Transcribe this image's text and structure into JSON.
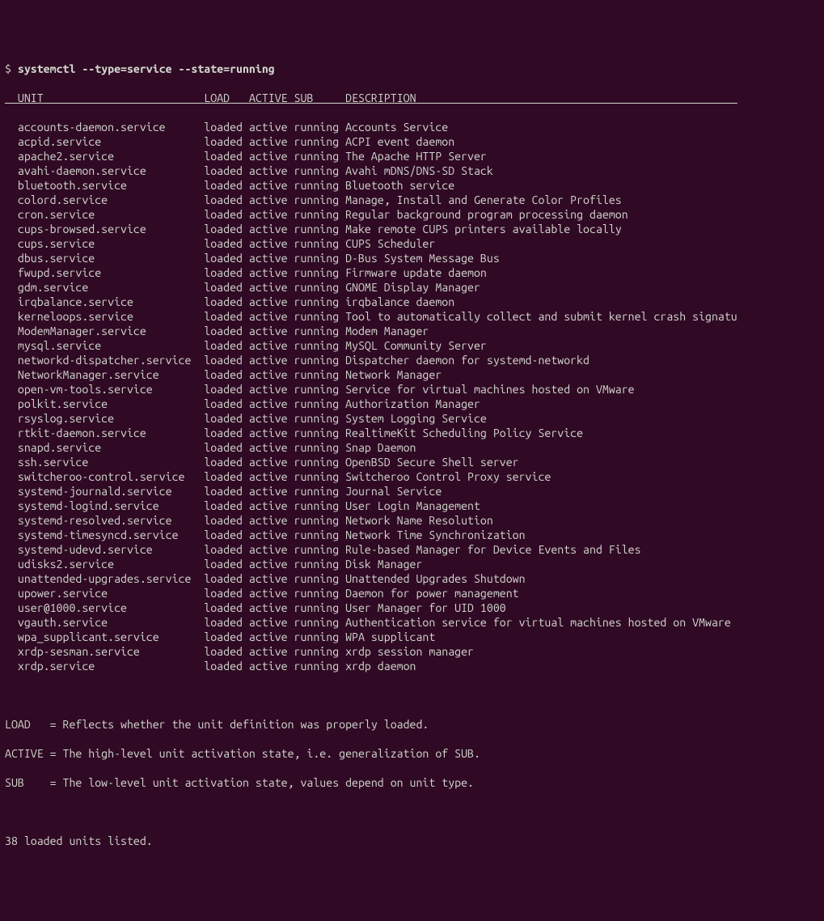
{
  "prompt": {
    "symbol": "$",
    "command": "systemctl --type=service --state=running"
  },
  "columns": {
    "unit": "UNIT",
    "load": "LOAD",
    "active": "ACTIVE",
    "sub": "SUB",
    "description": "DESCRIPTION"
  },
  "services": [
    {
      "unit": "accounts-daemon.service",
      "load": "loaded",
      "active": "active",
      "sub": "running",
      "desc": "Accounts Service"
    },
    {
      "unit": "acpid.service",
      "load": "loaded",
      "active": "active",
      "sub": "running",
      "desc": "ACPI event daemon"
    },
    {
      "unit": "apache2.service",
      "load": "loaded",
      "active": "active",
      "sub": "running",
      "desc": "The Apache HTTP Server"
    },
    {
      "unit": "avahi-daemon.service",
      "load": "loaded",
      "active": "active",
      "sub": "running",
      "desc": "Avahi mDNS/DNS-SD Stack"
    },
    {
      "unit": "bluetooth.service",
      "load": "loaded",
      "active": "active",
      "sub": "running",
      "desc": "Bluetooth service"
    },
    {
      "unit": "colord.service",
      "load": "loaded",
      "active": "active",
      "sub": "running",
      "desc": "Manage, Install and Generate Color Profiles"
    },
    {
      "unit": "cron.service",
      "load": "loaded",
      "active": "active",
      "sub": "running",
      "desc": "Regular background program processing daemon"
    },
    {
      "unit": "cups-browsed.service",
      "load": "loaded",
      "active": "active",
      "sub": "running",
      "desc": "Make remote CUPS printers available locally"
    },
    {
      "unit": "cups.service",
      "load": "loaded",
      "active": "active",
      "sub": "running",
      "desc": "CUPS Scheduler"
    },
    {
      "unit": "dbus.service",
      "load": "loaded",
      "active": "active",
      "sub": "running",
      "desc": "D-Bus System Message Bus"
    },
    {
      "unit": "fwupd.service",
      "load": "loaded",
      "active": "active",
      "sub": "running",
      "desc": "Firmware update daemon"
    },
    {
      "unit": "gdm.service",
      "load": "loaded",
      "active": "active",
      "sub": "running",
      "desc": "GNOME Display Manager"
    },
    {
      "unit": "irqbalance.service",
      "load": "loaded",
      "active": "active",
      "sub": "running",
      "desc": "irqbalance daemon"
    },
    {
      "unit": "kerneloops.service",
      "load": "loaded",
      "active": "active",
      "sub": "running",
      "desc": "Tool to automatically collect and submit kernel crash signatu"
    },
    {
      "unit": "ModemManager.service",
      "load": "loaded",
      "active": "active",
      "sub": "running",
      "desc": "Modem Manager"
    },
    {
      "unit": "mysql.service",
      "load": "loaded",
      "active": "active",
      "sub": "running",
      "desc": "MySQL Community Server"
    },
    {
      "unit": "networkd-dispatcher.service",
      "load": "loaded",
      "active": "active",
      "sub": "running",
      "desc": "Dispatcher daemon for systemd-networkd"
    },
    {
      "unit": "NetworkManager.service",
      "load": "loaded",
      "active": "active",
      "sub": "running",
      "desc": "Network Manager"
    },
    {
      "unit": "open-vm-tools.service",
      "load": "loaded",
      "active": "active",
      "sub": "running",
      "desc": "Service for virtual machines hosted on VMware"
    },
    {
      "unit": "polkit.service",
      "load": "loaded",
      "active": "active",
      "sub": "running",
      "desc": "Authorization Manager"
    },
    {
      "unit": "rsyslog.service",
      "load": "loaded",
      "active": "active",
      "sub": "running",
      "desc": "System Logging Service"
    },
    {
      "unit": "rtkit-daemon.service",
      "load": "loaded",
      "active": "active",
      "sub": "running",
      "desc": "RealtimeKit Scheduling Policy Service"
    },
    {
      "unit": "snapd.service",
      "load": "loaded",
      "active": "active",
      "sub": "running",
      "desc": "Snap Daemon"
    },
    {
      "unit": "ssh.service",
      "load": "loaded",
      "active": "active",
      "sub": "running",
      "desc": "OpenBSD Secure Shell server"
    },
    {
      "unit": "switcheroo-control.service",
      "load": "loaded",
      "active": "active",
      "sub": "running",
      "desc": "Switcheroo Control Proxy service"
    },
    {
      "unit": "systemd-journald.service",
      "load": "loaded",
      "active": "active",
      "sub": "running",
      "desc": "Journal Service"
    },
    {
      "unit": "systemd-logind.service",
      "load": "loaded",
      "active": "active",
      "sub": "running",
      "desc": "User Login Management"
    },
    {
      "unit": "systemd-resolved.service",
      "load": "loaded",
      "active": "active",
      "sub": "running",
      "desc": "Network Name Resolution"
    },
    {
      "unit": "systemd-timesyncd.service",
      "load": "loaded",
      "active": "active",
      "sub": "running",
      "desc": "Network Time Synchronization"
    },
    {
      "unit": "systemd-udevd.service",
      "load": "loaded",
      "active": "active",
      "sub": "running",
      "desc": "Rule-based Manager for Device Events and Files"
    },
    {
      "unit": "udisks2.service",
      "load": "loaded",
      "active": "active",
      "sub": "running",
      "desc": "Disk Manager"
    },
    {
      "unit": "unattended-upgrades.service",
      "load": "loaded",
      "active": "active",
      "sub": "running",
      "desc": "Unattended Upgrades Shutdown"
    },
    {
      "unit": "upower.service",
      "load": "loaded",
      "active": "active",
      "sub": "running",
      "desc": "Daemon for power management"
    },
    {
      "unit": "user@1000.service",
      "load": "loaded",
      "active": "active",
      "sub": "running",
      "desc": "User Manager for UID 1000"
    },
    {
      "unit": "vgauth.service",
      "load": "loaded",
      "active": "active",
      "sub": "running",
      "desc": "Authentication service for virtual machines hosted on VMware"
    },
    {
      "unit": "wpa_supplicant.service",
      "load": "loaded",
      "active": "active",
      "sub": "running",
      "desc": "WPA supplicant"
    },
    {
      "unit": "xrdp-sesman.service",
      "load": "loaded",
      "active": "active",
      "sub": "running",
      "desc": "xrdp session manager"
    },
    {
      "unit": "xrdp.service",
      "load": "loaded",
      "active": "active",
      "sub": "running",
      "desc": "xrdp daemon"
    }
  ],
  "legend": {
    "load": "LOAD   = Reflects whether the unit definition was properly loaded.",
    "active": "ACTIVE = The high-level unit activation state, i.e. generalization of SUB.",
    "sub": "SUB    = The low-level unit activation state, values depend on unit type."
  },
  "summary": "38 loaded units listed."
}
